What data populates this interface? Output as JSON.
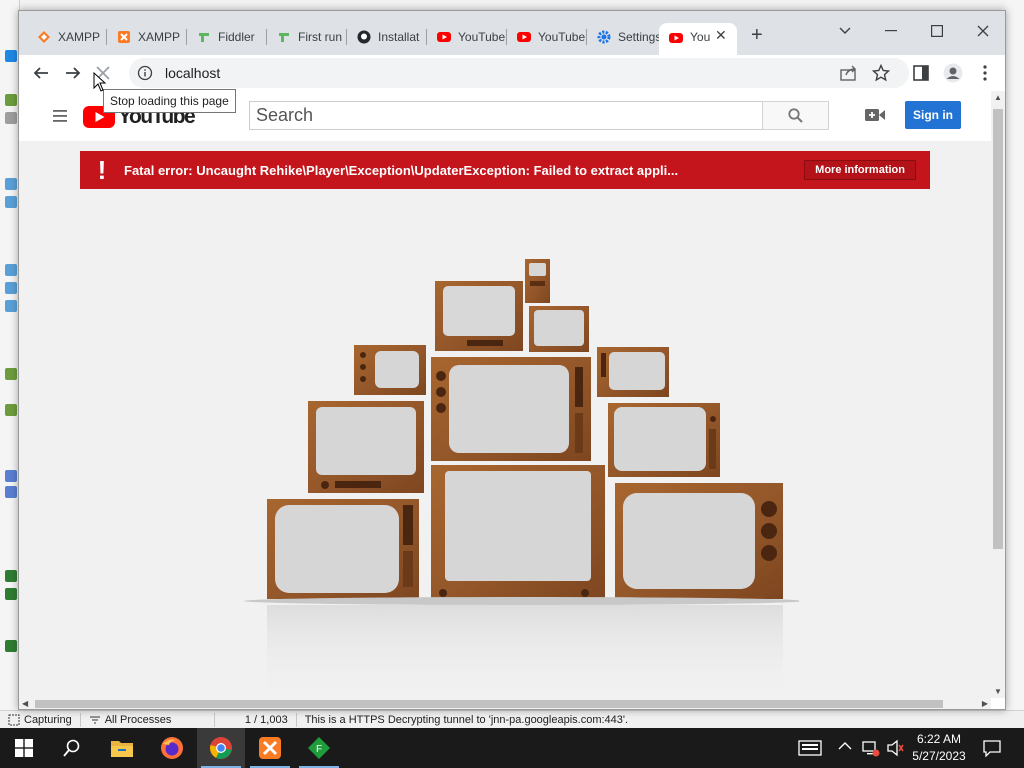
{
  "browser": {
    "tabs": [
      {
        "label": "XAMPP",
        "icon": "xampp-orange-icon"
      },
      {
        "label": "XAMPP",
        "icon": "xampp-logo-icon"
      },
      {
        "label": "Fiddler",
        "icon": "fiddler-icon"
      },
      {
        "label": "First run",
        "icon": "fiddler-icon"
      },
      {
        "label": "Installat",
        "icon": "github-icon"
      },
      {
        "label": "YouTube",
        "icon": "youtube-icon"
      },
      {
        "label": "YouTube",
        "icon": "youtube-icon"
      },
      {
        "label": "Settings",
        "icon": "gear-icon"
      },
      {
        "label": "You",
        "icon": "youtube-icon",
        "active": true
      }
    ],
    "url": "localhost",
    "tooltip": "Stop loading this page"
  },
  "youtube": {
    "logo_text": "YouTube",
    "search_placeholder": "Search",
    "sign_in": "Sign in",
    "error_message": "Fatal error: Uncaught Rehike\\Player\\Exception\\UpdaterException: Failed to extract appli...",
    "more_info": "More information"
  },
  "fiddler_status": {
    "capturing": "Capturing",
    "processes": "All Processes",
    "count": "1 / 1,003",
    "message": "This is a HTTPS Decrypting tunnel to 'jnn-pa.googleapis.com:443'."
  },
  "taskbar": {
    "time": "6:22 AM",
    "date": "5/27/2023"
  },
  "colors": {
    "error_red": "#c4151c",
    "signin_blue": "#2273d3",
    "youtube_red": "#ff0000"
  }
}
